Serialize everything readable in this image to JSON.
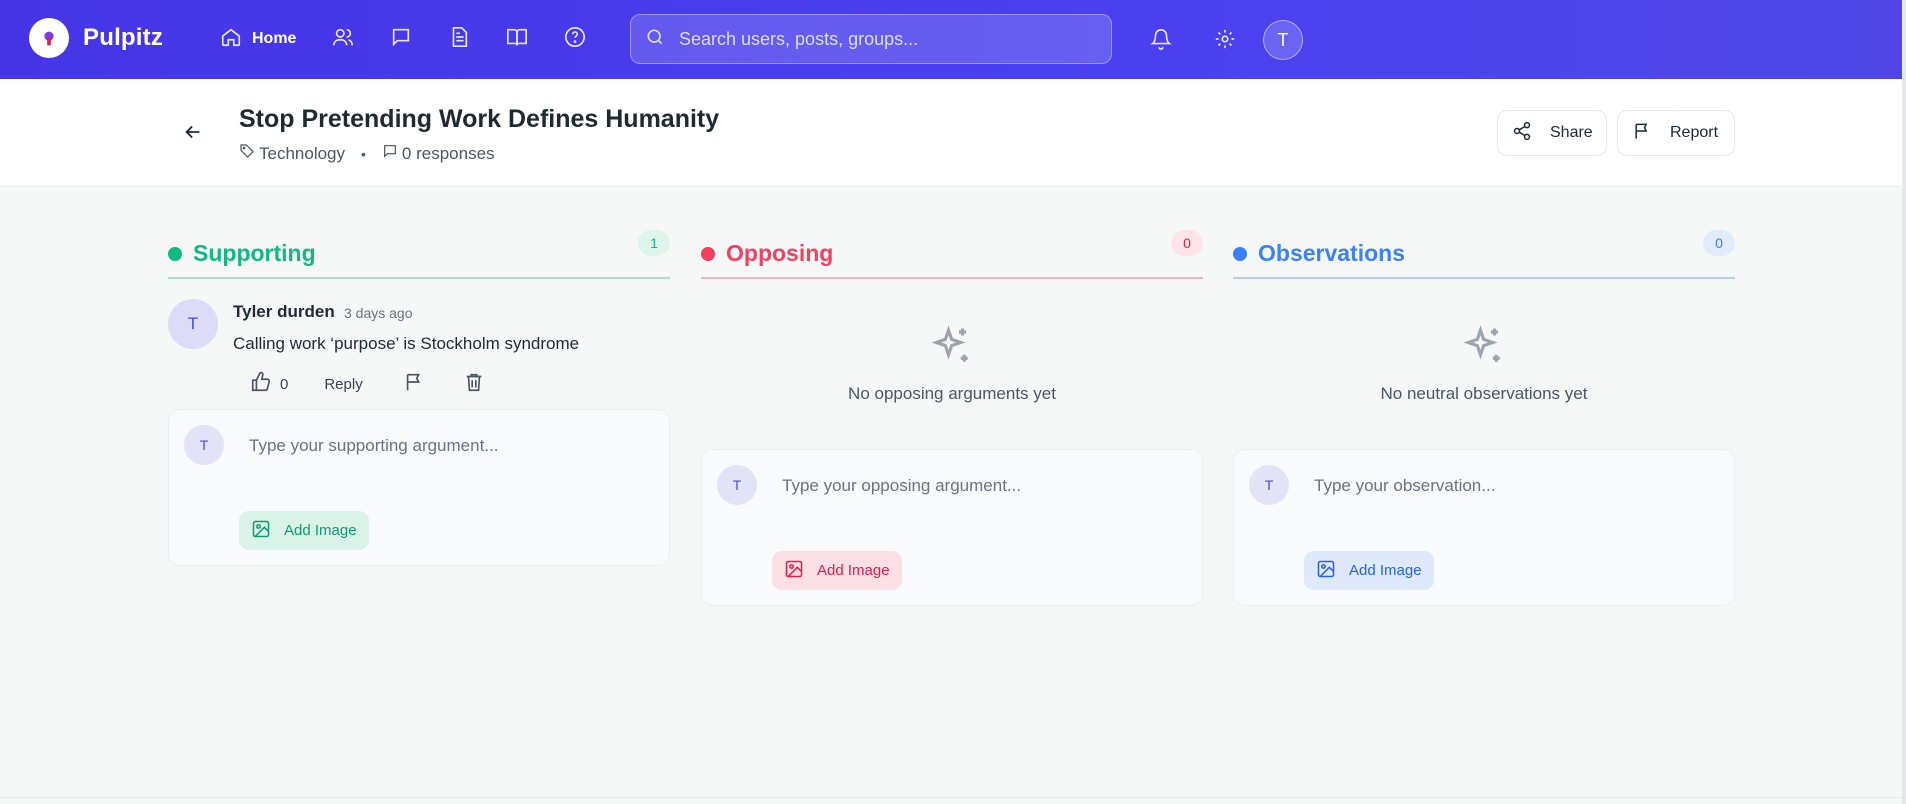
{
  "app": {
    "brand": "Pulpitz",
    "nav": [
      {
        "icon": "home-icon",
        "label": "Home"
      },
      {
        "icon": "users-icon",
        "label": ""
      },
      {
        "icon": "message-icon",
        "label": ""
      },
      {
        "icon": "document-icon",
        "label": ""
      },
      {
        "icon": "book-icon",
        "label": ""
      },
      {
        "icon": "help-icon",
        "label": ""
      }
    ],
    "search_placeholder": "Search users, posts, groups...",
    "user_initial": "T"
  },
  "header": {
    "title": "Stop Pretending Work Defines Humanity",
    "category": "Technology",
    "responses": "0 responses",
    "share_label": "Share",
    "report_label": "Report"
  },
  "columns": {
    "supporting": {
      "title": "Supporting",
      "count": "1",
      "accent": "#10b981",
      "comments": [
        {
          "avatar": "T",
          "author": "Tyler durden",
          "time": "3 days ago",
          "text": "Calling work ‘purpose’ is Stockholm syndrome",
          "likes": "0",
          "reply_label": "Reply"
        }
      ],
      "composer_avatar": "T",
      "composer_placeholder": "Type your supporting argument...",
      "add_image_label": "Add Image"
    },
    "opposing": {
      "title": "Opposing",
      "count": "0",
      "accent": "#f43f5e",
      "empty_text": "No opposing arguments yet",
      "composer_avatar": "T",
      "composer_placeholder": "Type your opposing argument...",
      "add_image_label": "Add Image"
    },
    "observations": {
      "title": "Observations",
      "count": "0",
      "accent": "#3b82f6",
      "empty_text": "No neutral observations yet",
      "composer_avatar": "T",
      "composer_placeholder": "Type your observation...",
      "add_image_label": "Add Image"
    }
  }
}
